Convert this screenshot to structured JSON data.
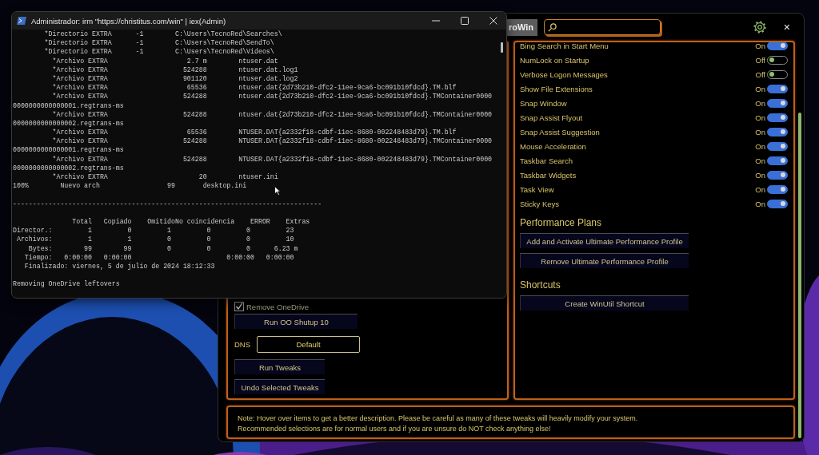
{
  "terminal": {
    "title": "Administrador: irm \"https://christitus.com/win\" | iex(Admin)",
    "blocks": [
      [
        "        *Directorio EXTRA      -1        C:\\Users\\TecnoRed\\Searches\\",
        "        *Directorio EXTRA      -1        C:\\Users\\TecnoRed\\SendTo\\",
        "        *Directorio EXTRA      -1        C:\\Users\\TecnoRed\\Videos\\",
        "          *Archivo EXTRA                    2.7 m        ntuser.dat",
        "          *Archivo EXTRA                   524288        ntuser.dat.log1",
        "          *Archivo EXTRA                   901120        ntuser.dat.log2",
        "          *Archivo EXTRA                    65536        ntuser.dat{2d73b210-dfc2-11ee-9ca6-bc091b10fdcd}.TM.blf",
        "          *Archivo EXTRA                   524288        ntuser.dat{2d73b210-dfc2-11ee-9ca6-bc091b10fdcd}.TMContainer0000",
        "0000000000000001.regtrans-ms",
        "          *Archivo EXTRA                   524288        ntuser.dat{2d73b210-dfc2-11ee-9ca6-bc091b10fdcd}.TMContainer0000",
        "0000000000000002.regtrans-ms",
        "          *Archivo EXTRA                    65536        NTUSER.DAT{a2332f18-cdbf-11ec-8680-002248483d79}.TM.blf",
        "          *Archivo EXTRA                   524288        NTUSER.DAT{a2332f18-cdbf-11ec-8680-002248483d79}.TMContainer0000",
        "0000000000000001.regtrans-ms",
        "          *Archivo EXTRA                   524288        NTUSER.DAT{a2332f18-cdbf-11ec-8680-002248483d79}.TMContainer0000",
        "0000000000000002.regtrans-ms",
        "          *Archivo EXTRA                       20        ntuser.ini",
        "100%        Nuevo arch                 99       desktop.ini"
      ],
      [
        "------------------------------------------------------------------------------"
      ],
      [
        "               Total   Copiado    OmitidoNo coincidencia    ERROR    Extras",
        "Director.:         1         0         1         0         0         23",
        " Archivos:         1         1         0         0         0         10",
        "    Bytes:        99        99         0         0         0      6.23 m",
        "   Tiempo:   0:00:00   0:00:00                        0:00:00   0:00:00",
        "   Finalizado: viernes, 5 de julio de 2024 18:12:33"
      ],
      [
        "Removing OneDrive leftovers"
      ]
    ]
  },
  "winutil": {
    "tab": {
      "label": "roWin",
      "selected": false
    },
    "close": "×",
    "left_panel": {
      "checkboxes": [
        {
          "label": "Remove OneDrive",
          "checked": true
        }
      ],
      "buttons": [
        "Run OO Shutup 10"
      ],
      "dns": {
        "label": "DNS",
        "value": "Default"
      },
      "actions": [
        "Run Tweaks",
        "Undo Selected Tweaks"
      ]
    },
    "right_panel": {
      "toggles": [
        {
          "label": "Bing Search in Start Menu",
          "on": true,
          "state_text": "On"
        },
        {
          "label": "NumLock on Startup",
          "on": false,
          "state_text": "Off"
        },
        {
          "label": "Verbose Logon Messages",
          "on": false,
          "state_text": "Off"
        },
        {
          "label": "Show File Extensions",
          "on": true,
          "state_text": "On"
        },
        {
          "label": "Snap Window",
          "on": true,
          "state_text": "On"
        },
        {
          "label": "Snap Assist Flyout",
          "on": true,
          "state_text": "On"
        },
        {
          "label": "Snap Assist Suggestion",
          "on": true,
          "state_text": "On"
        },
        {
          "label": "Mouse Acceleration",
          "on": true,
          "state_text": "On"
        },
        {
          "label": "Taskbar Search",
          "on": true,
          "state_text": "On"
        },
        {
          "label": "Taskbar Widgets",
          "on": true,
          "state_text": "On"
        },
        {
          "label": "Task View",
          "on": true,
          "state_text": "On"
        },
        {
          "label": "Sticky Keys",
          "on": true,
          "state_text": "On"
        }
      ],
      "sections": [
        {
          "heading": "Performance Plans",
          "buttons": [
            "Add and Activate Ultimate Performance Profile",
            "Remove Ultimate Performance Profile"
          ]
        },
        {
          "heading": "Shortcuts",
          "buttons": [
            "Create WinUtil Shortcut"
          ]
        }
      ]
    },
    "note": [
      "Note: Hover over items to get a better description. Please be careful as many of these tweaks will heavily modify your system.",
      "Recommended selections are for normal users and if you are unsure do NOT check anything else!"
    ]
  }
}
